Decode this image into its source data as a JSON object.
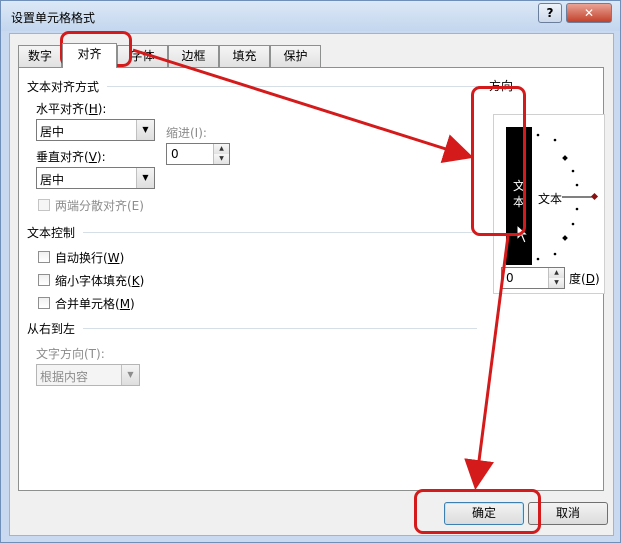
{
  "window": {
    "title": "设置单元格格式",
    "help_label": "?",
    "close_label": "✕"
  },
  "tabs": [
    {
      "label": "数字"
    },
    {
      "label": "对齐"
    },
    {
      "label": "字体"
    },
    {
      "label": "边框"
    },
    {
      "label": "填充"
    },
    {
      "label": "保护"
    }
  ],
  "alignment": {
    "section_title": "文本对齐方式",
    "horizontal_label": "水平对齐(",
    "horizontal_key": "H",
    "horizontal_suffix": "):",
    "horizontal_value": "居中",
    "indent_label": "缩进(I):",
    "indent_value": "0",
    "vertical_label": "垂直对齐(",
    "vertical_key": "V",
    "vertical_suffix": "):",
    "vertical_value": "居中",
    "distributed_label": "两端分散对齐(E)"
  },
  "text_control": {
    "section_title": "文本控制",
    "wrap_label": "自动换行(",
    "wrap_key": "W",
    "shrink_label": "缩小字体填充(",
    "shrink_key": "K",
    "merge_label": "合并单元格(",
    "merge_key": "M",
    "close_paren": ")"
  },
  "rtl": {
    "section_title": "从右到左",
    "direction_label": "文字方向(T):",
    "direction_value": "根据内容"
  },
  "orientation": {
    "section_title": "方向",
    "vertical_char_1": "文",
    "vertical_char_2": "本",
    "dial_text": "文本",
    "degrees_value": "0",
    "degrees_label": "度(",
    "degrees_key": "D",
    "degrees_suffix": ")"
  },
  "buttons": {
    "ok_label": "确定",
    "cancel_label": "取消"
  },
  "colors": {
    "highlight": "#d41a1a"
  }
}
